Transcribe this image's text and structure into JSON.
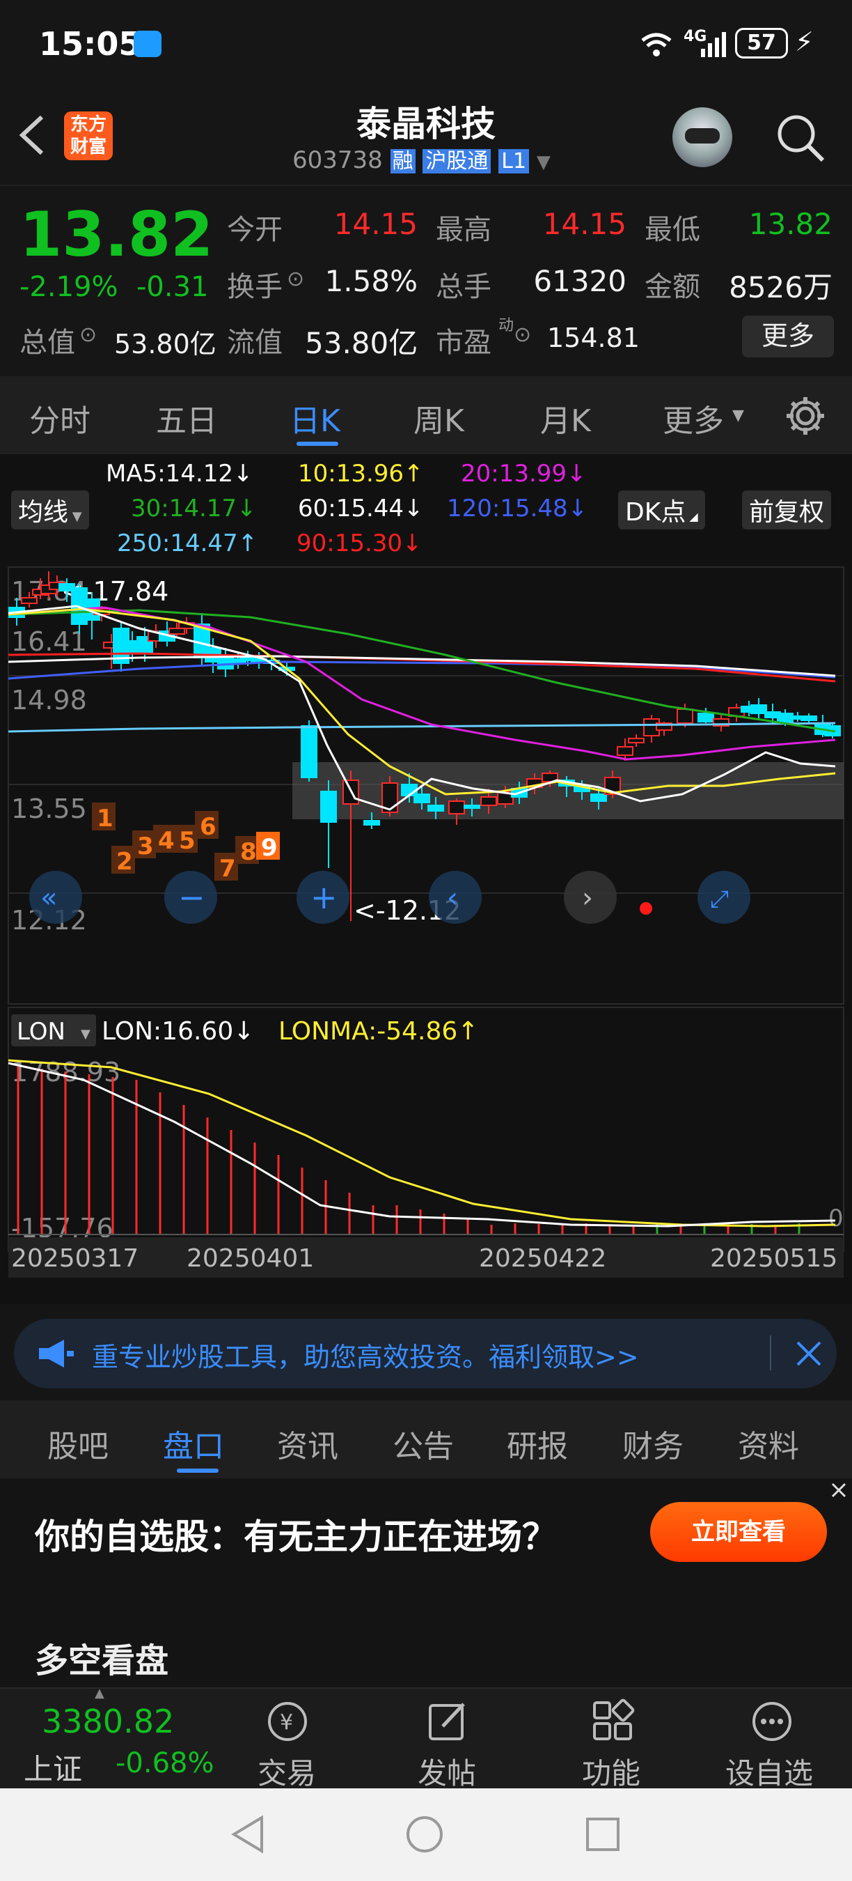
{
  "status": {
    "time": "15:05",
    "network": "4G",
    "battery": "57"
  },
  "header": {
    "app_badge_line1": "东方",
    "app_badge_line2": "财富",
    "stock_name": "泰晶科技",
    "stock_code": "603738",
    "tag_margin": "融",
    "tag_connect": "沪股通",
    "tag_level": "L1"
  },
  "quote": {
    "price": "13.82",
    "change_pct": "-2.19%",
    "change": "-0.31",
    "open_label": "今开",
    "open": "14.15",
    "high_label": "最高",
    "high": "14.15",
    "low_label": "最低",
    "low": "13.82",
    "turnover_label": "换手",
    "turnover": "1.58%",
    "volume_label": "总手",
    "volume": "61320",
    "amount_label": "金额",
    "amount": "8526万",
    "mktcap_label": "总值",
    "mktcap": "53.80亿",
    "float_label": "流值",
    "float": "53.80亿",
    "pe_label": "市盈",
    "pe_sup": "动",
    "pe": "154.81",
    "more": "更多"
  },
  "tabs": [
    "分时",
    "五日",
    "日K",
    "周K",
    "月K",
    "更多"
  ],
  "active_tab": "日K",
  "ma": {
    "ma5": "MA5:14.12↓",
    "ma10": "10:13.96↑",
    "ma20": "20:13.99↓",
    "ma30": "30:14.17↓",
    "ma60": "60:15.44↓",
    "ma120": "120:15.48↓",
    "ma250": "250:14.47↑",
    "ma90": "90:15.30↓",
    "selector": "均线",
    "dk": "DK点",
    "adjust": "前复权"
  },
  "chart": {
    "axis": [
      "17.84",
      "16.41",
      "14.98",
      "13.55",
      "12.12"
    ],
    "max_label": "<-17.84",
    "min_label": "<-12.12",
    "td_counts": [
      "1",
      "2",
      "3",
      "4",
      "5",
      "6",
      "7",
      "8",
      "9"
    ],
    "lon_selector": "LON",
    "lon": "LON:16.60↓",
    "lonma": "LONMA:-54.86↑",
    "lon_axis_top": "1788.93",
    "lon_axis_bottom": "-157.76",
    "lon_zero": "0",
    "dates": [
      "20250317",
      "20250401",
      "20250422",
      "20250515"
    ],
    "colors": {
      "up": "#ff2a2a",
      "down": "#00e5ff",
      "ma5": "#ffffff",
      "ma10": "#ffee33",
      "ma20": "#e020e0",
      "ma30": "#20b020",
      "ma60": "#ffffff",
      "ma120": "#4060ff",
      "ma250": "#66ccff",
      "ma90": "#ff2020"
    }
  },
  "banner": {
    "text": "重专业炒股工具，助您高效投资。福利领取>>"
  },
  "ftabs": [
    "股吧",
    "盘口",
    "资讯",
    "公告",
    "研报",
    "财务",
    "资料"
  ],
  "ftab_active": "盘口",
  "ad": {
    "text": "你的自选股：有无主力正在进场？",
    "button": "立即查看",
    "section": "多空看盘"
  },
  "bottom": {
    "index_value": "3380.82",
    "index_name": "上证",
    "index_change": "-0.68%",
    "trade": "交易",
    "post": "发帖",
    "func": "功能",
    "watch": "设自选"
  }
}
